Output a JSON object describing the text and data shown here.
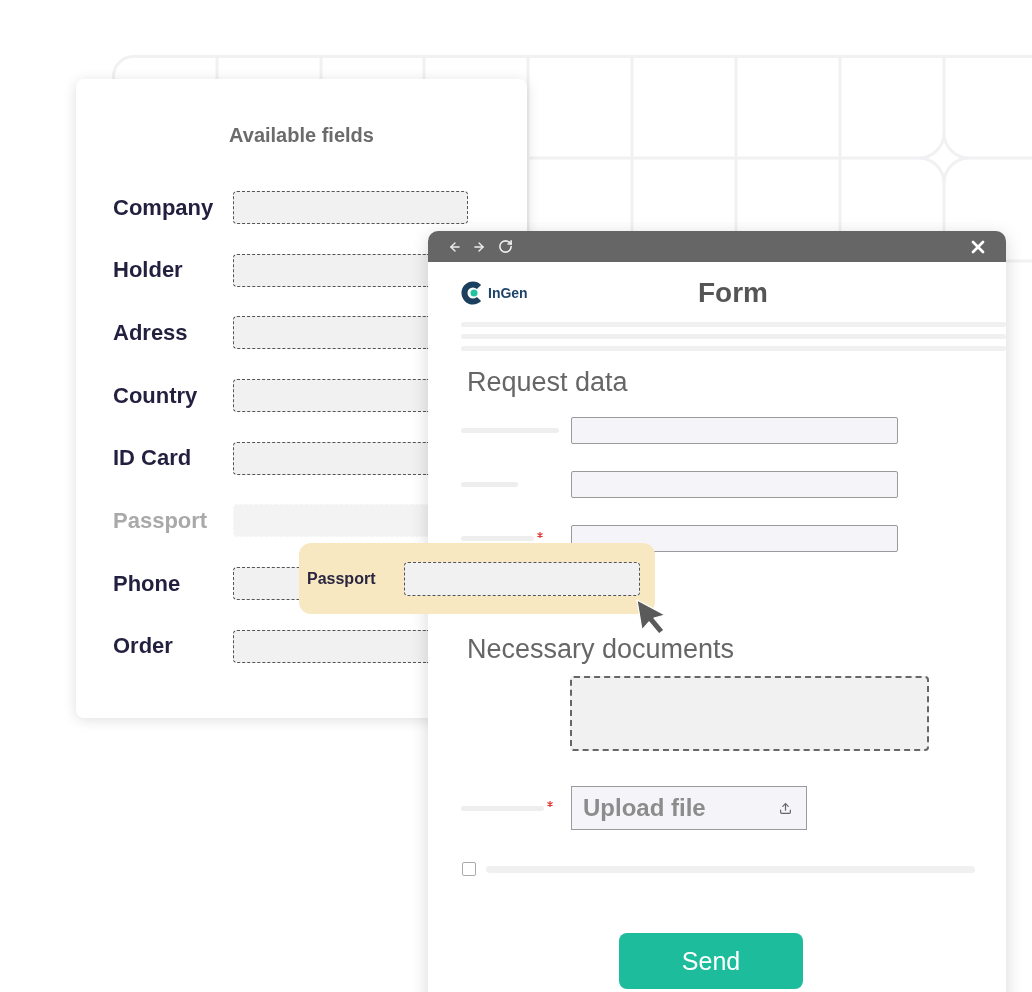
{
  "available_fields": {
    "title": "Available fields",
    "fields": [
      {
        "label": "Company",
        "dragged": false
      },
      {
        "label": "Holder",
        "dragged": false
      },
      {
        "label": "Adress",
        "dragged": false
      },
      {
        "label": "Country",
        "dragged": false
      },
      {
        "label": "ID Card",
        "dragged": false
      },
      {
        "label": "Passport",
        "dragged": true
      },
      {
        "label": "Phone",
        "dragged": false
      },
      {
        "label": "Order",
        "dragged": false
      }
    ]
  },
  "dragged_field": {
    "label": "Passport"
  },
  "browser_window": {
    "logo": "InGen",
    "title": "Form",
    "sections": [
      {
        "title": "Request data",
        "rows": [
          {
            "kind": "input",
            "required": false
          },
          {
            "kind": "input",
            "required": false
          },
          {
            "kind": "input",
            "required": true
          }
        ]
      },
      {
        "title": "Necessary documents",
        "rows": [
          {
            "kind": "dropzone"
          },
          {
            "kind": "upload",
            "label": "Upload file",
            "required": true
          },
          {
            "kind": "checkbox",
            "checked": false
          }
        ]
      }
    ],
    "send_button": "Send"
  }
}
